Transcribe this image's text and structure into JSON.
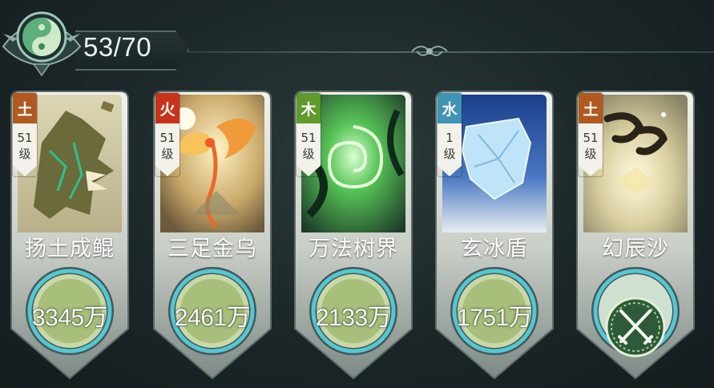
{
  "header": {
    "counter": "53/70",
    "emblem_icon": "taiji-eye-icon"
  },
  "colors": {
    "earth": "#b15a1f",
    "fire": "#c8331c",
    "wood": "#5f9a2c",
    "water": "#3f93b3",
    "dial_fill": "#a7bf7a",
    "dial_ring": "#53c8d2"
  },
  "cards": [
    {
      "element": "土",
      "level_num": "51",
      "level_unit": "级",
      "name": "扬土成鲲",
      "power": "3345万",
      "art_icon": "earth-beast-icon"
    },
    {
      "element": "火",
      "level_num": "51",
      "level_unit": "级",
      "name": "三足金乌",
      "power": "2461万",
      "art_icon": "golden-phoenix-icon"
    },
    {
      "element": "木",
      "level_num": "51",
      "level_unit": "级",
      "name": "万法树界",
      "power": "2133万",
      "art_icon": "green-vortex-icon"
    },
    {
      "element": "水",
      "level_num": "1",
      "level_unit": "级",
      "name": "玄冰盾",
      "power": "1751万",
      "art_icon": "ice-shield-icon"
    },
    {
      "element": "土",
      "level_num": "51",
      "level_unit": "级",
      "name": "幻辰沙",
      "power": "",
      "art_icon": "sand-glyph-icon",
      "dial_icon": "crossed-swords-icon"
    }
  ]
}
